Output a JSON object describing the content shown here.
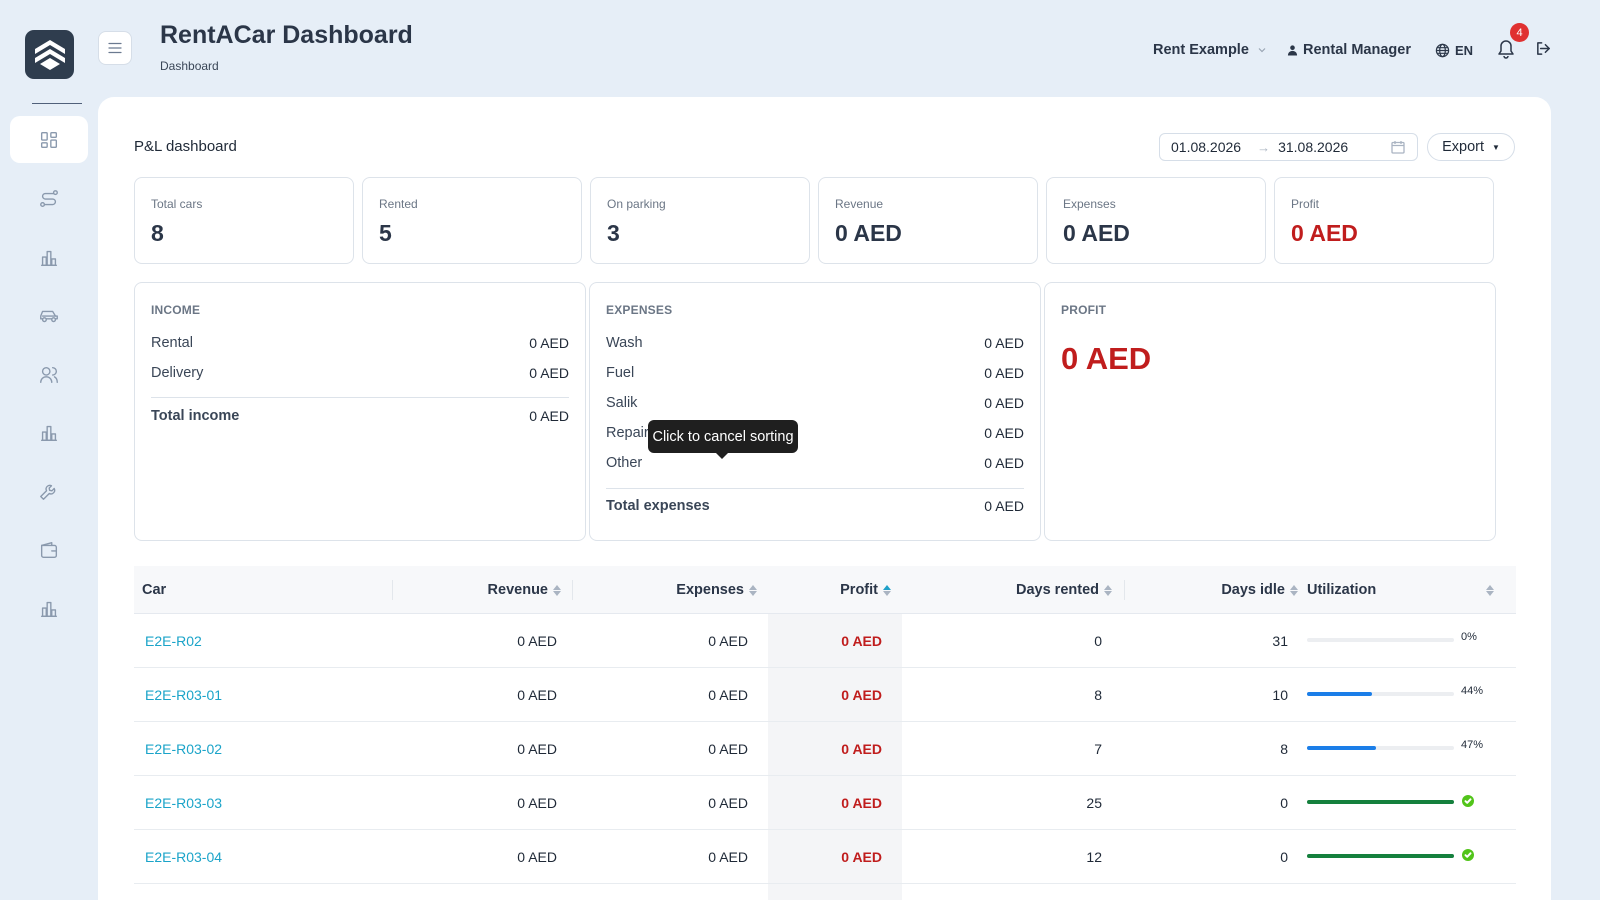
{
  "header": {
    "title": "RentACar Dashboard",
    "breadcrumb": "Dashboard",
    "company": "Rent Example",
    "user": "Rental Manager",
    "language": "EN",
    "notifications_count": "4"
  },
  "sidebar": {
    "items": [
      {
        "icon": "dashboard-icon",
        "active": true
      },
      {
        "icon": "route-icon",
        "active": false
      },
      {
        "icon": "chart-icon",
        "active": false
      },
      {
        "icon": "car-icon",
        "active": false
      },
      {
        "icon": "users-icon",
        "active": false
      },
      {
        "icon": "chart-icon",
        "active": false
      },
      {
        "icon": "wrench-icon",
        "active": false
      },
      {
        "icon": "wallet-icon",
        "active": false
      },
      {
        "icon": "chart-icon",
        "active": false
      }
    ]
  },
  "main": {
    "section_title": "P&L dashboard",
    "date_from": "01.08.2026",
    "date_to": "31.08.2026",
    "export_label": "Export",
    "stats": [
      {
        "label": "Total cars",
        "value": "8"
      },
      {
        "label": "Rented",
        "value": "5"
      },
      {
        "label": "On parking",
        "value": "3"
      },
      {
        "label": "Revenue",
        "value": "0 AED"
      },
      {
        "label": "Expenses",
        "value": "0 AED"
      },
      {
        "label": "Profit",
        "value": "0 AED"
      }
    ],
    "income": {
      "title": "INCOME",
      "rows": [
        {
          "label": "Rental",
          "amount": "0 AED"
        },
        {
          "label": "Delivery",
          "amount": "0 AED"
        }
      ],
      "total_label": "Total income",
      "total_amount": "0 AED"
    },
    "expenses": {
      "title": "EXPENSES",
      "rows": [
        {
          "label": "Wash",
          "amount": "0 AED"
        },
        {
          "label": "Fuel",
          "amount": "0 AED"
        },
        {
          "label": "Salik",
          "amount": "0 AED"
        },
        {
          "label": "Repair",
          "amount": "0 AED"
        },
        {
          "label": "Other",
          "amount": "0 AED"
        }
      ],
      "total_label": "Total expenses",
      "total_amount": "0 AED"
    },
    "profit": {
      "title": "PROFIT",
      "amount": "0 AED"
    },
    "tooltip": "Click to cancel sorting",
    "table": {
      "columns": [
        "Car",
        "Revenue",
        "Expenses",
        "Profit",
        "Days rented",
        "Days idle",
        "Utilization"
      ],
      "rows": [
        {
          "car": "E2E-R02",
          "revenue": "0 AED",
          "expenses": "0 AED",
          "profit": "0 AED",
          "days_rented": "0",
          "days_idle": "31",
          "utilization": 0,
          "utilization_label": "0%"
        },
        {
          "car": "E2E-R03-01",
          "revenue": "0 AED",
          "expenses": "0 AED",
          "profit": "0 AED",
          "days_rented": "8",
          "days_idle": "10",
          "utilization": 44,
          "utilization_label": "44%"
        },
        {
          "car": "E2E-R03-02",
          "revenue": "0 AED",
          "expenses": "0 AED",
          "profit": "0 AED",
          "days_rented": "7",
          "days_idle": "8",
          "utilization": 47,
          "utilization_label": "47%"
        },
        {
          "car": "E2E-R03-03",
          "revenue": "0 AED",
          "expenses": "0 AED",
          "profit": "0 AED",
          "days_rented": "25",
          "days_idle": "0",
          "utilization": 100,
          "utilization_label": ""
        },
        {
          "car": "E2E-R03-04",
          "revenue": "0 AED",
          "expenses": "0 AED",
          "profit": "0 AED",
          "days_rented": "12",
          "days_idle": "0",
          "utilization": 100,
          "utilization_label": ""
        }
      ]
    }
  },
  "colors": {
    "accent": "#1ba4c9",
    "negative": "#c01d1d",
    "progress_partial": "#1b7ee8",
    "progress_full": "#15803d",
    "badge": "#e03131"
  }
}
